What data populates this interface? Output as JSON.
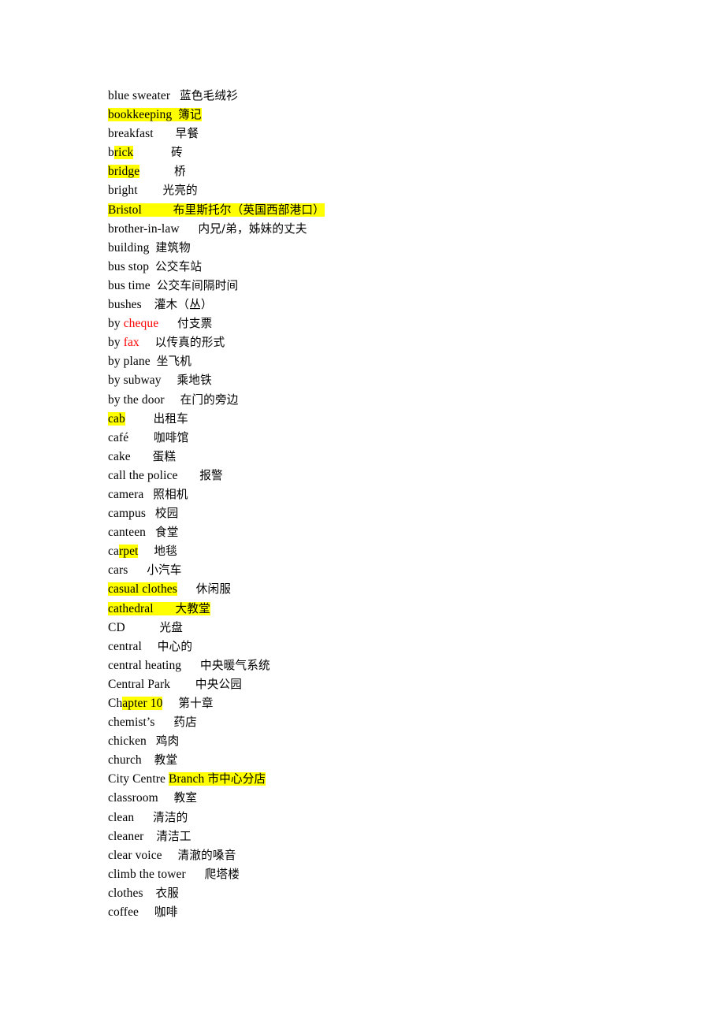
{
  "document": {
    "type": "bilingual-vocabulary-glossary",
    "page_background": "#ffffff",
    "text_color": "#000000",
    "highlight_color": "#ffff00",
    "accent_color": "#ff0000",
    "entries": [
      {
        "id": "blue-sweater",
        "term": "blue sweater",
        "gap": "   ",
        "translation": "蓝色毛绒衫",
        "highlight": "none"
      },
      {
        "id": "bookkeeping",
        "term": "bookkeeping",
        "gap": "  ",
        "translation": "簿记",
        "highlight": "full"
      },
      {
        "id": "breakfast",
        "term": "breakfast",
        "gap": "       ",
        "translation": "早餐",
        "highlight": "none"
      },
      {
        "id": "brick",
        "term": "brick",
        "term_plain_prefix": "b",
        "term_highlighted": "rick",
        "gap": "            ",
        "translation": "砖",
        "highlight": "partial-term"
      },
      {
        "id": "bridge",
        "term": "bridge",
        "gap": "           ",
        "translation": "桥",
        "highlight": "term-only"
      },
      {
        "id": "bright",
        "term": "bright",
        "gap": "        ",
        "translation": "光亮的",
        "highlight": "none"
      },
      {
        "id": "bristol",
        "term": "Bristol",
        "gap": "          ",
        "translation": "布里斯托尔（英国西部港口）",
        "highlight": "full"
      },
      {
        "id": "brother-in-law",
        "term": "brother-in-law",
        "gap": "      ",
        "translation": "内兄/弟，姊妹的丈夫",
        "highlight": "none"
      },
      {
        "id": "building",
        "term": "building",
        "gap": "  ",
        "translation": "建筑物",
        "highlight": "none"
      },
      {
        "id": "bus-stop",
        "term": "bus stop",
        "gap": "  ",
        "translation": "公交车站",
        "highlight": "none"
      },
      {
        "id": "bus-time",
        "term": "bus time",
        "gap": "  ",
        "translation": "公交车间隔时间",
        "highlight": "none"
      },
      {
        "id": "bushes",
        "term": "bushes",
        "gap": "    ",
        "translation": "灌木（丛）",
        "highlight": "none"
      },
      {
        "id": "by-cheque",
        "term_plain_prefix": "by ",
        "term_red": "cheque",
        "term": "by cheque",
        "gap": "      ",
        "translation": "付支票",
        "highlight": "none",
        "red_word": "cheque"
      },
      {
        "id": "by-fax",
        "term_plain_prefix": "by ",
        "term_red": "fax",
        "term": "by fax",
        "gap": "     ",
        "translation": "以传真的形式",
        "highlight": "none",
        "red_word": "fax"
      },
      {
        "id": "by-plane",
        "term": "by plane",
        "gap": "  ",
        "translation": "坐飞机",
        "highlight": "none"
      },
      {
        "id": "by-subway",
        "term": "by subway",
        "gap": "     ",
        "translation": "乘地铁",
        "highlight": "none"
      },
      {
        "id": "by-the-door",
        "term": "by the door",
        "gap": "     ",
        "translation": "在门的旁边",
        "highlight": "none"
      },
      {
        "id": "cab",
        "term": "cab",
        "gap": "         ",
        "translation": "出租车",
        "highlight": "term-only"
      },
      {
        "id": "cafe",
        "term": "café",
        "gap": "        ",
        "translation": "咖啡馆",
        "highlight": "none"
      },
      {
        "id": "cake",
        "term": "cake",
        "gap": "       ",
        "translation": "蛋糕",
        "highlight": "none"
      },
      {
        "id": "call-the-police",
        "term": "call the police",
        "gap": "       ",
        "translation": "报警",
        "highlight": "none"
      },
      {
        "id": "camera",
        "term": "camera",
        "gap": "   ",
        "translation": "照相机",
        "highlight": "none"
      },
      {
        "id": "campus",
        "term": "campus",
        "gap": "   ",
        "translation": "校园",
        "highlight": "none"
      },
      {
        "id": "canteen",
        "term": "canteen",
        "gap": "   ",
        "translation": "食堂",
        "highlight": "none"
      },
      {
        "id": "carpet",
        "term": "carpet",
        "term_plain_prefix": "ca",
        "term_highlighted": "rpet",
        "gap": "     ",
        "translation": "地毯",
        "highlight": "partial-term"
      },
      {
        "id": "cars",
        "term": "cars",
        "gap": "      ",
        "translation": "小汽车",
        "highlight": "none"
      },
      {
        "id": "casual-clothes",
        "term": "casual clothes",
        "gap": "      ",
        "translation": "休闲服",
        "highlight": "term-only"
      },
      {
        "id": "cathedral",
        "term": "cathedral",
        "gap": "       ",
        "translation": "大教堂",
        "highlight": "full"
      },
      {
        "id": "cd",
        "term": "CD",
        "gap": "           ",
        "translation": "光盘",
        "highlight": "none"
      },
      {
        "id": "central",
        "term": "central",
        "gap": "     ",
        "translation": "中心的",
        "highlight": "none"
      },
      {
        "id": "central-heating",
        "term": "central heating",
        "gap": "      ",
        "translation": "中央暖气系统",
        "highlight": "none"
      },
      {
        "id": "central-park",
        "term": "Central Park",
        "gap": "        ",
        "translation": "中央公园",
        "highlight": "none"
      },
      {
        "id": "chapter-10",
        "term": "Chapter 10",
        "term_plain_prefix": "Ch",
        "term_highlighted": "apter 10",
        "gap": "     ",
        "translation": "第十章",
        "highlight": "partial-term"
      },
      {
        "id": "chemists",
        "term": "chemist’s",
        "gap": "      ",
        "translation": "药店",
        "highlight": "none"
      },
      {
        "id": "chicken",
        "term": "chicken",
        "gap": "   ",
        "translation": "鸡肉",
        "highlight": "none"
      },
      {
        "id": "church",
        "term": "church",
        "gap": "    ",
        "translation": "教堂",
        "highlight": "none"
      },
      {
        "id": "city-centre-branch",
        "term": "City Centre Branch",
        "term_plain_prefix": "City Centre ",
        "term_highlighted": "Branch",
        "gap": " ",
        "translation": "市中心分店",
        "highlight": "partial-term-and-translation"
      },
      {
        "id": "classroom",
        "term": "classroom",
        "gap": "     ",
        "translation": "教室",
        "highlight": "none"
      },
      {
        "id": "clean",
        "term": "clean",
        "gap": "      ",
        "translation": "清洁的",
        "highlight": "none"
      },
      {
        "id": "cleaner",
        "term": "cleaner",
        "gap": "    ",
        "translation": "清洁工",
        "highlight": "none"
      },
      {
        "id": "clear-voice",
        "term": "clear voice",
        "gap": "     ",
        "translation": "清澈的嗓音",
        "highlight": "none"
      },
      {
        "id": "climb-the-tower",
        "term": "climb the tower",
        "gap": "      ",
        "translation": "爬塔楼",
        "highlight": "none"
      },
      {
        "id": "clothes",
        "term": "clothes",
        "gap": "    ",
        "translation": "衣服",
        "highlight": "none"
      },
      {
        "id": "coffee",
        "term": "coffee",
        "gap": "     ",
        "translation": "咖啡",
        "highlight": "none"
      }
    ]
  }
}
